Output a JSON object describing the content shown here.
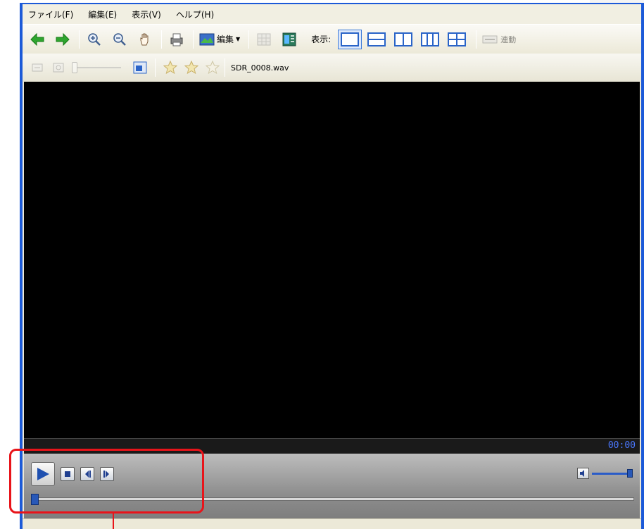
{
  "menu": [
    "ファイル(F)",
    "編集(E)",
    "表示(V)",
    "ヘルプ(H)"
  ],
  "toolbar1": {
    "edit_label": "編集",
    "view_label": "表示:",
    "link_label": "連動"
  },
  "toolbar2": {
    "filename": "SDR_0008.wav"
  },
  "player": {
    "time": "00:00",
    "seek_position": 0.0,
    "volume_level": 1.0
  },
  "colors": {
    "accent": "#1c5ad8",
    "highlight": "#e8141a",
    "time_text": "#4a78ff"
  }
}
